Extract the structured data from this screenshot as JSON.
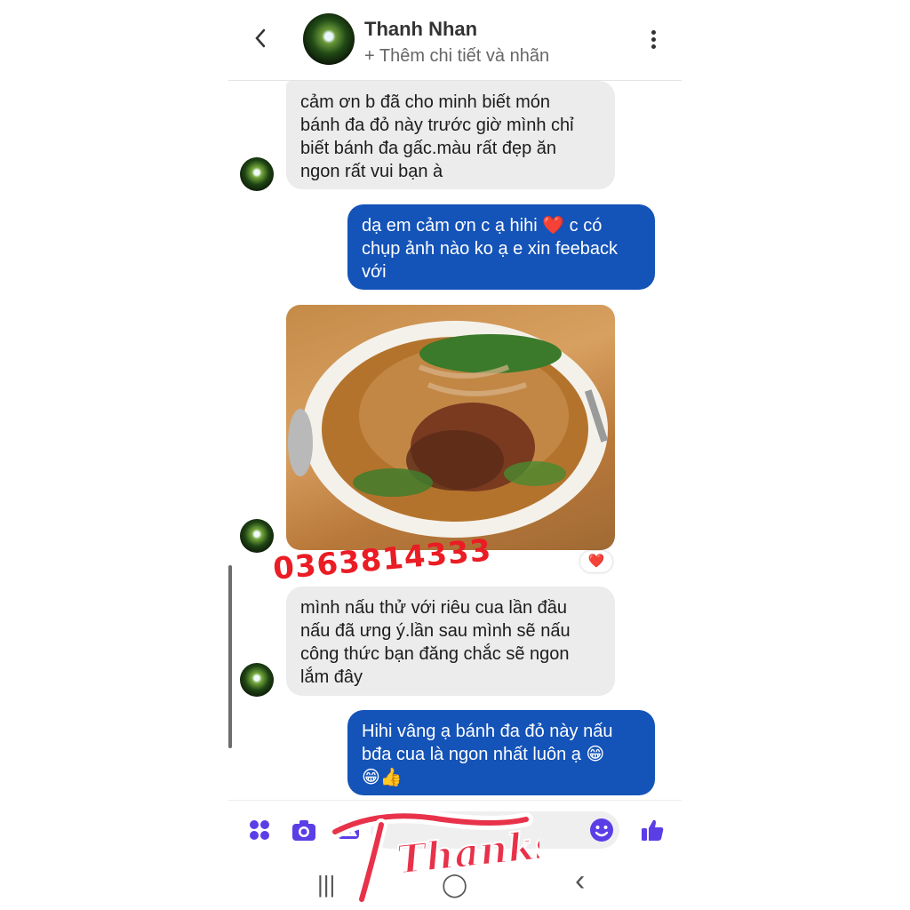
{
  "header": {
    "contact_name": "Thanh Nhan",
    "add_details": "+ Thêm chi tiết và nhãn"
  },
  "messages": [
    {
      "side": "in",
      "lines": [
        "cảm ơn b đã cho minh biết món",
        "bánh đa đỏ này trước giờ mình chỉ",
        "biết bánh đa gấc.màu rất đẹp ăn",
        "ngon rất vui bạn à"
      ]
    },
    {
      "side": "out",
      "lines": [
        "dạ em cảm ơn c ạ hihi ❤️ c có",
        "chụp ảnh nào ko ạ e xin feeback",
        "với"
      ]
    },
    {
      "side": "in",
      "type": "photo",
      "reaction": "❤️"
    },
    {
      "side": "in",
      "lines": [
        "mình nấu thử với riêu cua lần đầu",
        "nấu đã ưng ý.lần sau mình sẽ nấu",
        "công thức bạn đăng chắc sẽ ngon",
        "lắm đây"
      ]
    },
    {
      "side": "out",
      "lines": [
        "Hihi vâng ạ bánh đa đỏ này nấu",
        "bđa cua là ngon nhất luôn ạ 😁",
        "😁👍"
      ]
    }
  ],
  "overlay": {
    "phone_watermark": "0363814333",
    "sticker_text": "Thanks"
  },
  "toolbar": {
    "icons": [
      "apps-icon",
      "camera-icon",
      "gallery-icon",
      "emoji-icon",
      "like-icon"
    ]
  },
  "navbar": {
    "recent": "|||",
    "home": "◯",
    "back": "‹"
  },
  "colors": {
    "accent": "#1453b8",
    "icon_purple": "#5b3ee6",
    "incoming_bg": "#ececec",
    "watermark": "#ea1c24"
  }
}
